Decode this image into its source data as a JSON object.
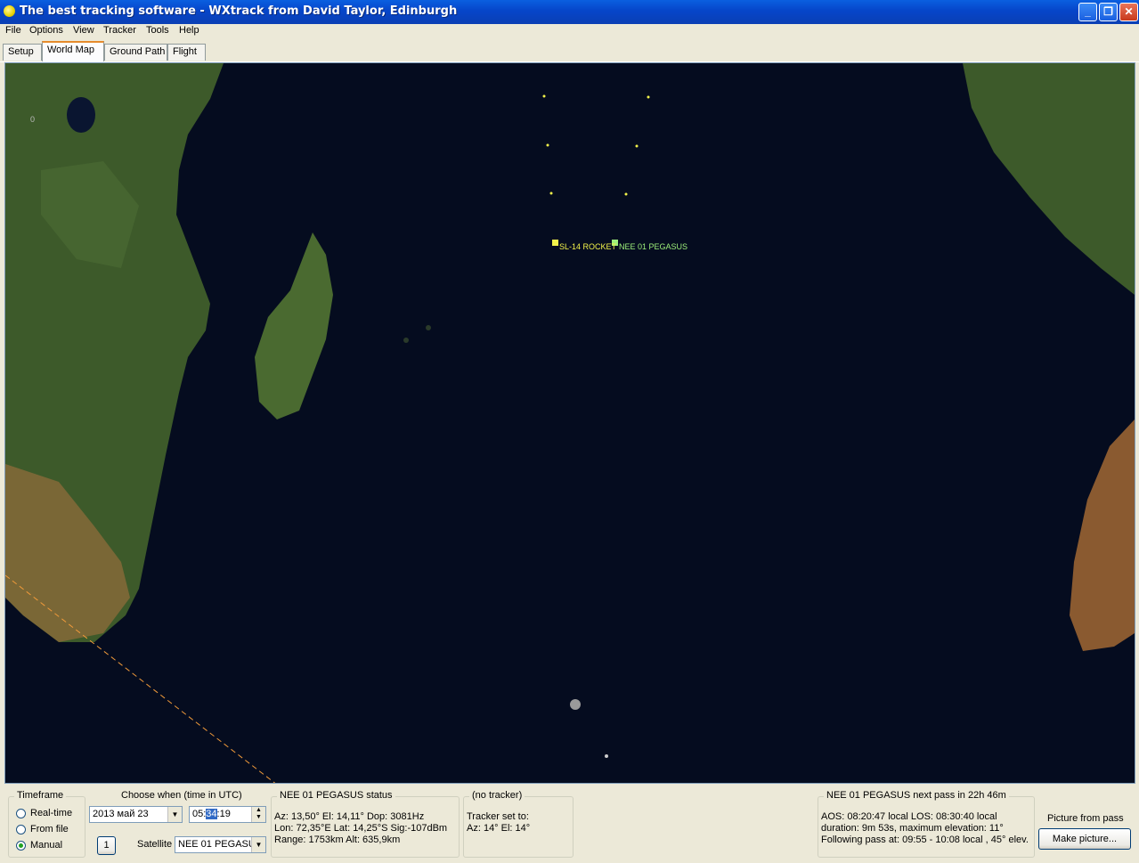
{
  "window": {
    "title": "The best tracking software - WXtrack from David Taylor, Edinburgh"
  },
  "menu": [
    "File",
    "Options",
    "View",
    "Tracker",
    "Tools",
    "Help"
  ],
  "tabs": [
    "Setup",
    "World Map",
    "Ground Path",
    "Flight"
  ],
  "map": {
    "lat_label": "0",
    "satellites": [
      {
        "name": "SL-14 ROCKET",
        "color": "#f2f24a"
      },
      {
        "name": "NEE 01 PEGASUS",
        "color": "#9ef07a"
      }
    ],
    "colors": {
      "ocean": "#050c1f",
      "land": "#3d5a2a",
      "desert": "#8a6a3a",
      "track": "#f09a3a"
    }
  },
  "timeframe": {
    "title": "Timeframe",
    "options": [
      "Real-time",
      "From file",
      "Manual"
    ],
    "selected": "Manual"
  },
  "choose": {
    "title": "Choose when (time in UTC)",
    "date": "2013 май 23",
    "time_hh": "05:",
    "time_mm": "34",
    "time_ss": ":19",
    "step_button": "1",
    "satellite_label": "Satellite",
    "satellite_value": "NEE 01 PEGASUS"
  },
  "status": {
    "title": "NEE 01 PEGASUS status",
    "line1": "Az: 13,50°  El: 14,11°  Dop: 3081Hz",
    "line2": "Lon: 72,35°E  Lat: 14,25°S  Sig:-107dBm",
    "line3": "Range: 1753km  Alt: 635,9km"
  },
  "tracker": {
    "title": "(no tracker)",
    "line1": "Tracker set to:",
    "line2": "Az: 14°  El: 14°"
  },
  "nextpass": {
    "title": "NEE 01 PEGASUS next pass in 22h 46m",
    "line1": "AOS: 08:20:47 local  LOS: 08:30:40 local",
    "line2": "duration: 9m 53s,  maximum elevation: 11°",
    "line3": "Following pass at: 09:55 - 10:08 local , 45° elev."
  },
  "picture": {
    "title": "Picture from pass",
    "button": "Make picture..."
  }
}
